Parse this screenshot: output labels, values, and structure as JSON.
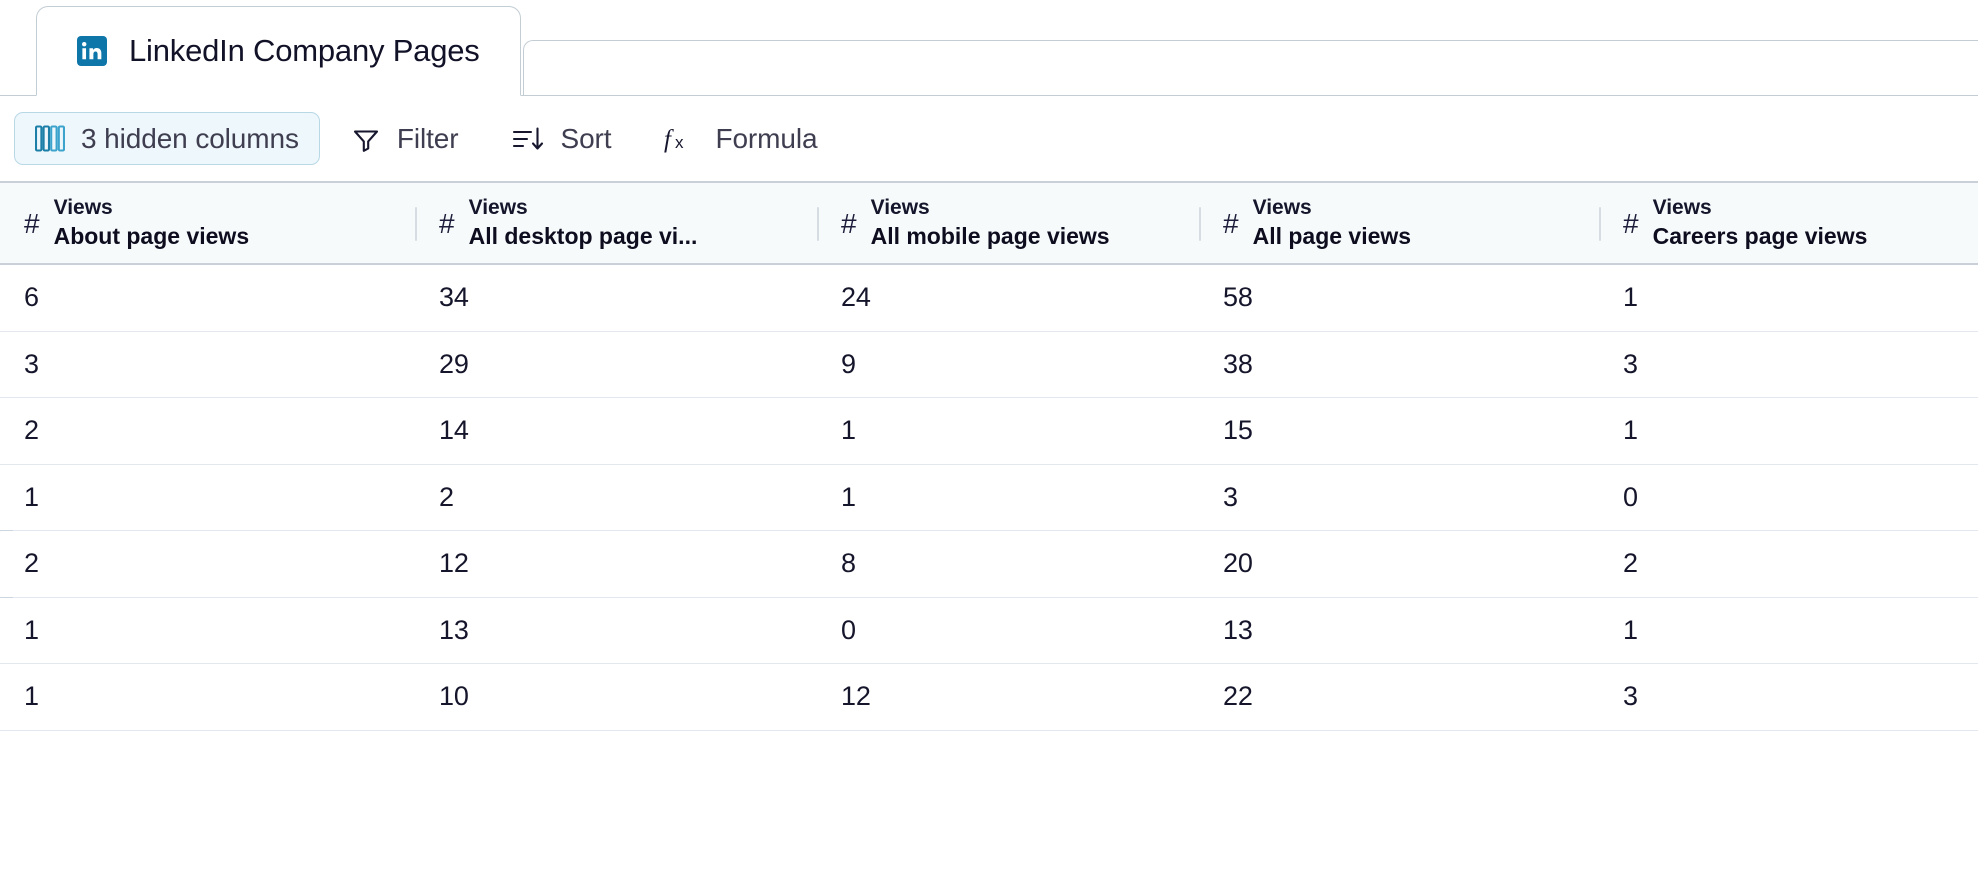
{
  "tab": {
    "icon": "linkedin-icon",
    "title": "LinkedIn Company Pages"
  },
  "toolbar": {
    "hidden_columns_label": "3 hidden columns",
    "hidden_columns_icon": "columns-icon",
    "hidden_columns_active": true,
    "filter_label": "Filter",
    "filter_icon": "funnel-icon",
    "sort_label": "Sort",
    "sort_icon": "sort-descending-icon",
    "formula_label": "Formula",
    "formula_icon": "fx-icon",
    "accent_color": "#0e76a8",
    "active_bg": "#eef7fb",
    "active_border": "#b9d8e6"
  },
  "grid": {
    "type_icon": "number-field-icon",
    "columns": [
      {
        "group": "Views",
        "name": "About page views",
        "type": "#"
      },
      {
        "group": "Views",
        "name": "All desktop page vi...",
        "type": "#"
      },
      {
        "group": "Views",
        "name": "All mobile page views",
        "type": "#"
      },
      {
        "group": "Views",
        "name": "All page views",
        "type": "#"
      },
      {
        "group": "Views",
        "name": "Careers page views",
        "type": "#"
      }
    ],
    "rows": [
      {
        "selected": false,
        "cells": [
          "6",
          "34",
          "24",
          "58",
          "1"
        ]
      },
      {
        "selected": false,
        "cells": [
          "3",
          "29",
          "9",
          "38",
          "3"
        ]
      },
      {
        "selected": false,
        "cells": [
          "2",
          "14",
          "1",
          "15",
          "1"
        ]
      },
      {
        "selected": false,
        "cells": [
          "1",
          "2",
          "1",
          "3",
          "0"
        ]
      },
      {
        "selected": true,
        "cells": [
          "2",
          "12",
          "8",
          "20",
          "2"
        ]
      },
      {
        "selected": false,
        "cells": [
          "1",
          "13",
          "0",
          "13",
          "1"
        ]
      },
      {
        "selected": false,
        "cells": [
          "1",
          "10",
          "12",
          "22",
          "3"
        ]
      }
    ]
  }
}
